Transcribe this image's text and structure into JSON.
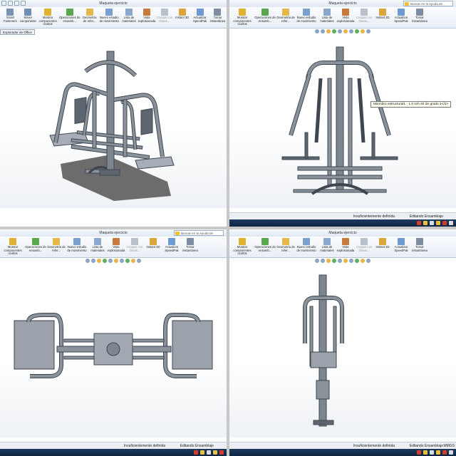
{
  "app": {
    "document_title": "Maqueta ejercicio",
    "search_placeholder": "Buscar en la Ayuda de SolidWorks"
  },
  "ribbon": {
    "items": [
      {
        "label": "Smart Fasteners",
        "icon": "fastener-icon",
        "color": "#7a93b5"
      },
      {
        "label": "Mover componente",
        "icon": "move-component-icon",
        "color": "#6f8fb8"
      },
      {
        "label": "Mostrar componentes ocultos",
        "icon": "show-hidden-icon",
        "color": "#e0b030"
      },
      {
        "label": "Operaciones de ensamb...",
        "icon": "assembly-features-icon",
        "color": "#5aa84e"
      },
      {
        "label": "Geometría de refer...",
        "icon": "reference-geometry-icon",
        "color": "#e4b94a"
      },
      {
        "label": "Nuevo estudio de movimiento",
        "icon": "motion-study-icon",
        "color": "#7aa0d0"
      },
      {
        "label": "Lista de materiales",
        "icon": "bom-icon",
        "color": "#8aa8cc"
      },
      {
        "label": "Vista explosionada",
        "icon": "exploded-view-icon",
        "color": "#c87a3a"
      },
      {
        "label": "Croquis con líneas...",
        "icon": "explode-line-icon",
        "color": "#b8c0cc",
        "disabled": true
      },
      {
        "label": "Instant 3D",
        "icon": "instant3d-icon",
        "color": "#d9a53c"
      },
      {
        "label": "Actualizar SpeedPak",
        "icon": "speedpak-icon",
        "color": "#6d9ad0"
      },
      {
        "label": "Tomar instantánea",
        "icon": "snapshot-icon",
        "color": "#7e8ea2"
      }
    ]
  },
  "views": {
    "isometric": {
      "context_label": "Explorador de Office"
    },
    "front": {
      "tooltip": "Miembro estructural1 - 1.0 sch 40 de grado 1</2>"
    },
    "top": {},
    "side": {}
  },
  "status": {
    "definition": "Insuficientemente definida",
    "editing": "Editando Ensamblaje",
    "units": "MMGS"
  },
  "colors": {
    "model_fill": "#8a929c",
    "model_stroke": "#3f4650",
    "shadow": "#6c6c6c"
  }
}
